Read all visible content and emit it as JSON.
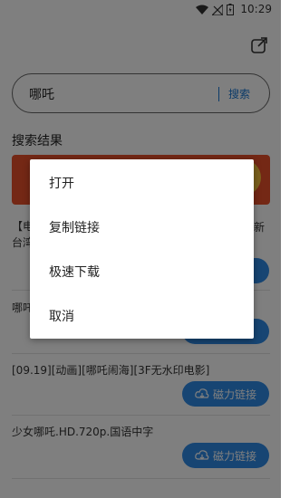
{
  "status_bar": {
    "time": "10:29",
    "icons": [
      "wifi-icon",
      "signal-off-icon",
      "battery-icon"
    ]
  },
  "header": {
    "share_icon": "share-icon"
  },
  "search": {
    "query": "哪吒",
    "button_label": "搜索"
  },
  "results": {
    "section_title": "搜索结果",
    "rows": [
      {
        "title": "【电",
        "extra": "新"
      },
      {
        "title": "台湾"
      },
      {
        "title": "哪吒"
      },
      {
        "title": "[09.19][动画][哪吒闹海][3F无水印电影]",
        "button": "磁力链接"
      },
      {
        "title": "少女哪吒.HD.720p.国语中字",
        "button": "磁力链接"
      }
    ]
  },
  "context_menu": {
    "items": [
      {
        "label": "打开"
      },
      {
        "label": "复制链接"
      },
      {
        "label": "极速下载"
      },
      {
        "label": "取消"
      }
    ]
  },
  "colors": {
    "accent": "#1976d2",
    "button": "#2e8ae6",
    "banner": "#e8512b",
    "scrim": "rgba(0,0,0,0.5)"
  }
}
